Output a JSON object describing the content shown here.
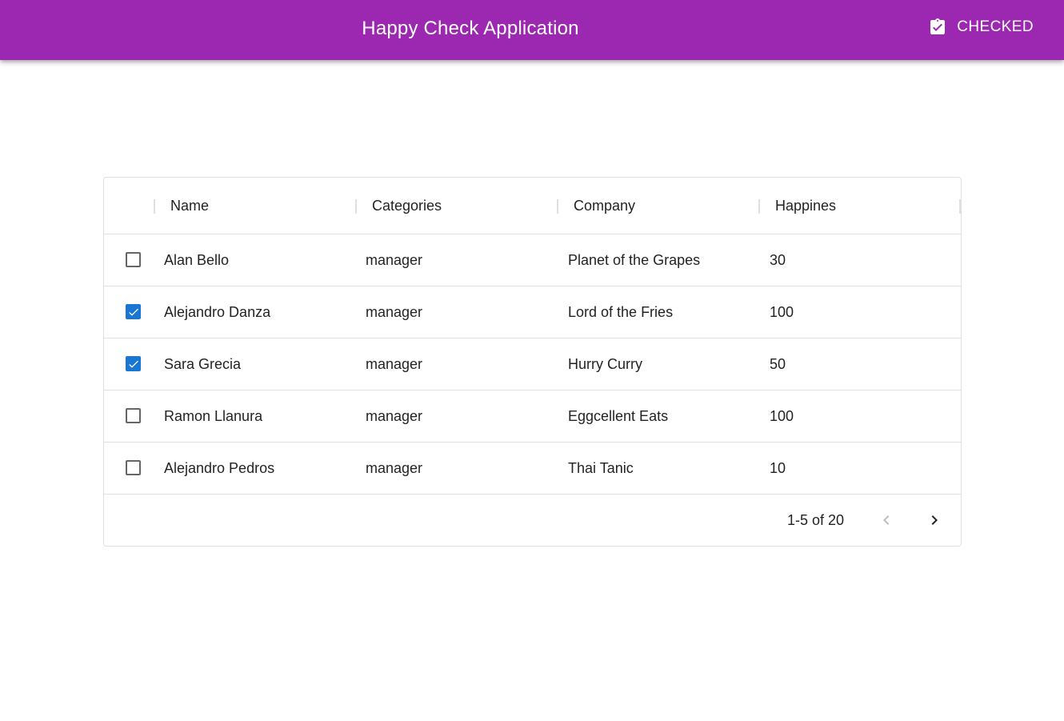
{
  "app": {
    "title": "Happy Check Application",
    "checked_button_label": "CHECKED",
    "checked_icon": "clipboard-check-icon",
    "bar_color": "#9c27b0"
  },
  "table": {
    "columns": [
      "Name",
      "Categories",
      "Company",
      "Happines"
    ],
    "rows": [
      {
        "name": "Alan Bello",
        "category": "manager",
        "company": "Planet of the Grapes",
        "happiness": "30",
        "checked": false
      },
      {
        "name": "Alejandro Danza",
        "category": "manager",
        "company": "Lord of the Fries",
        "happiness": "100",
        "checked": true
      },
      {
        "name": "Sara Grecia",
        "category": "manager",
        "company": "Hurry Curry",
        "happiness": "50",
        "checked": true
      },
      {
        "name": "Ramon Llanura",
        "category": "manager",
        "company": "Eggcellent Eats",
        "happiness": "100",
        "checked": false
      },
      {
        "name": "Alejandro Pedros",
        "category": "manager",
        "company": "Thai Tanic",
        "happiness": "10",
        "checked": false
      }
    ],
    "checkbox_color": "#1976d2"
  },
  "pagination": {
    "range_text": "1-5 of 20",
    "prev_icon": "chevron-left-icon",
    "next_icon": "chevron-right-icon",
    "prev_disabled": true
  }
}
